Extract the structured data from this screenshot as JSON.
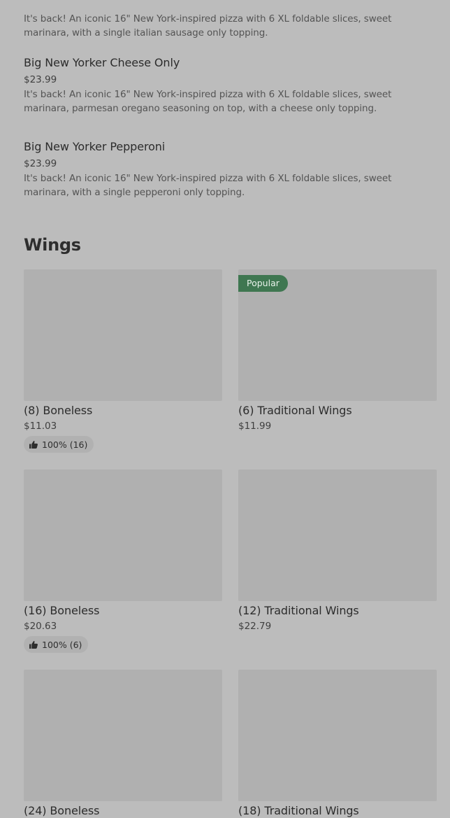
{
  "partial_item": {
    "description": "It's back! An iconic 16\" New York-inspired pizza with 6 XL foldable slices, sweet marinara, with a single italian sausage only topping."
  },
  "pizza_items": [
    {
      "name": "Big New Yorker Cheese Only",
      "price": "$23.99",
      "description": "It's back! An iconic 16\" New York-inspired pizza with 6 XL foldable slices, sweet marinara, parmesan oregano seasoning on top, with a cheese only topping."
    },
    {
      "name": "Big New Yorker Pepperoni",
      "price": "$23.99",
      "description": "It's back! An iconic 16\" New York-inspired pizza with 6 XL foldable slices, sweet marinara, with a single pepperoni only topping."
    }
  ],
  "wings": {
    "title": "Wings",
    "cards": [
      {
        "name": "(8) Boneless",
        "price": "$11.03",
        "badge": "",
        "rating": "100% (16)"
      },
      {
        "name": "(6) Traditional Wings",
        "price": "$11.99",
        "badge": "Popular",
        "rating": ""
      },
      {
        "name": "(16) Boneless",
        "price": "$20.63",
        "badge": "",
        "rating": "100% (6)"
      },
      {
        "name": "(12) Traditional Wings",
        "price": "$22.79",
        "badge": "",
        "rating": ""
      },
      {
        "name": "(24) Boneless",
        "price": "",
        "badge": "",
        "rating": ""
      },
      {
        "name": "(18) Traditional Wings",
        "price": "",
        "badge": "",
        "rating": ""
      }
    ]
  },
  "icons": {
    "rating": "thumbs-up-icon"
  },
  "colors": {
    "background": "#bcbcbc",
    "image_placeholder": "#b0b0b0",
    "badge_background": "#3f7751",
    "rating_pill": "#b1b1b1"
  }
}
